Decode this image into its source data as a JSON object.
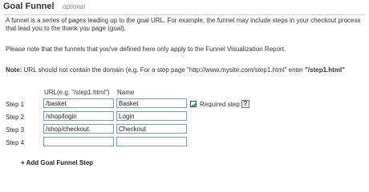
{
  "header": {
    "title": "Goal Funnel",
    "optional_label": "optional"
  },
  "intro": {
    "paragraph1": "A funnel is a series of pages leading up to the goal URL. For example, the funnel may include steps in your checkout process that lead you to the thank you page (goal).",
    "paragraph2": "Please note that the funnels that you've defined here only apply to the Funnel Visualization Report.",
    "note_label": "Note:",
    "note_text": " URL should not contain the domain (e.g. For a step page \"http://www.mysite.com/step1.html\" enter ",
    "note_example": "\"/step1.html\""
  },
  "columns": {
    "url_header": "URL(e.g. \"/step1.html\")",
    "name_header": "Name"
  },
  "steps": [
    {
      "label": "Step 1",
      "url": "/basket",
      "name": "Basket"
    },
    {
      "label": "Step 2",
      "url": "/shop/login",
      "name": "Login"
    },
    {
      "label": "Step 3",
      "url": "/shop/checkout.",
      "name": "Checkout"
    },
    {
      "label": "Step 4",
      "url": "",
      "name": ""
    }
  ],
  "required_step": {
    "label": "Required step",
    "checked": true,
    "help_glyph": "?"
  },
  "add_step_label": "+ Add Goal Funnel Step"
}
